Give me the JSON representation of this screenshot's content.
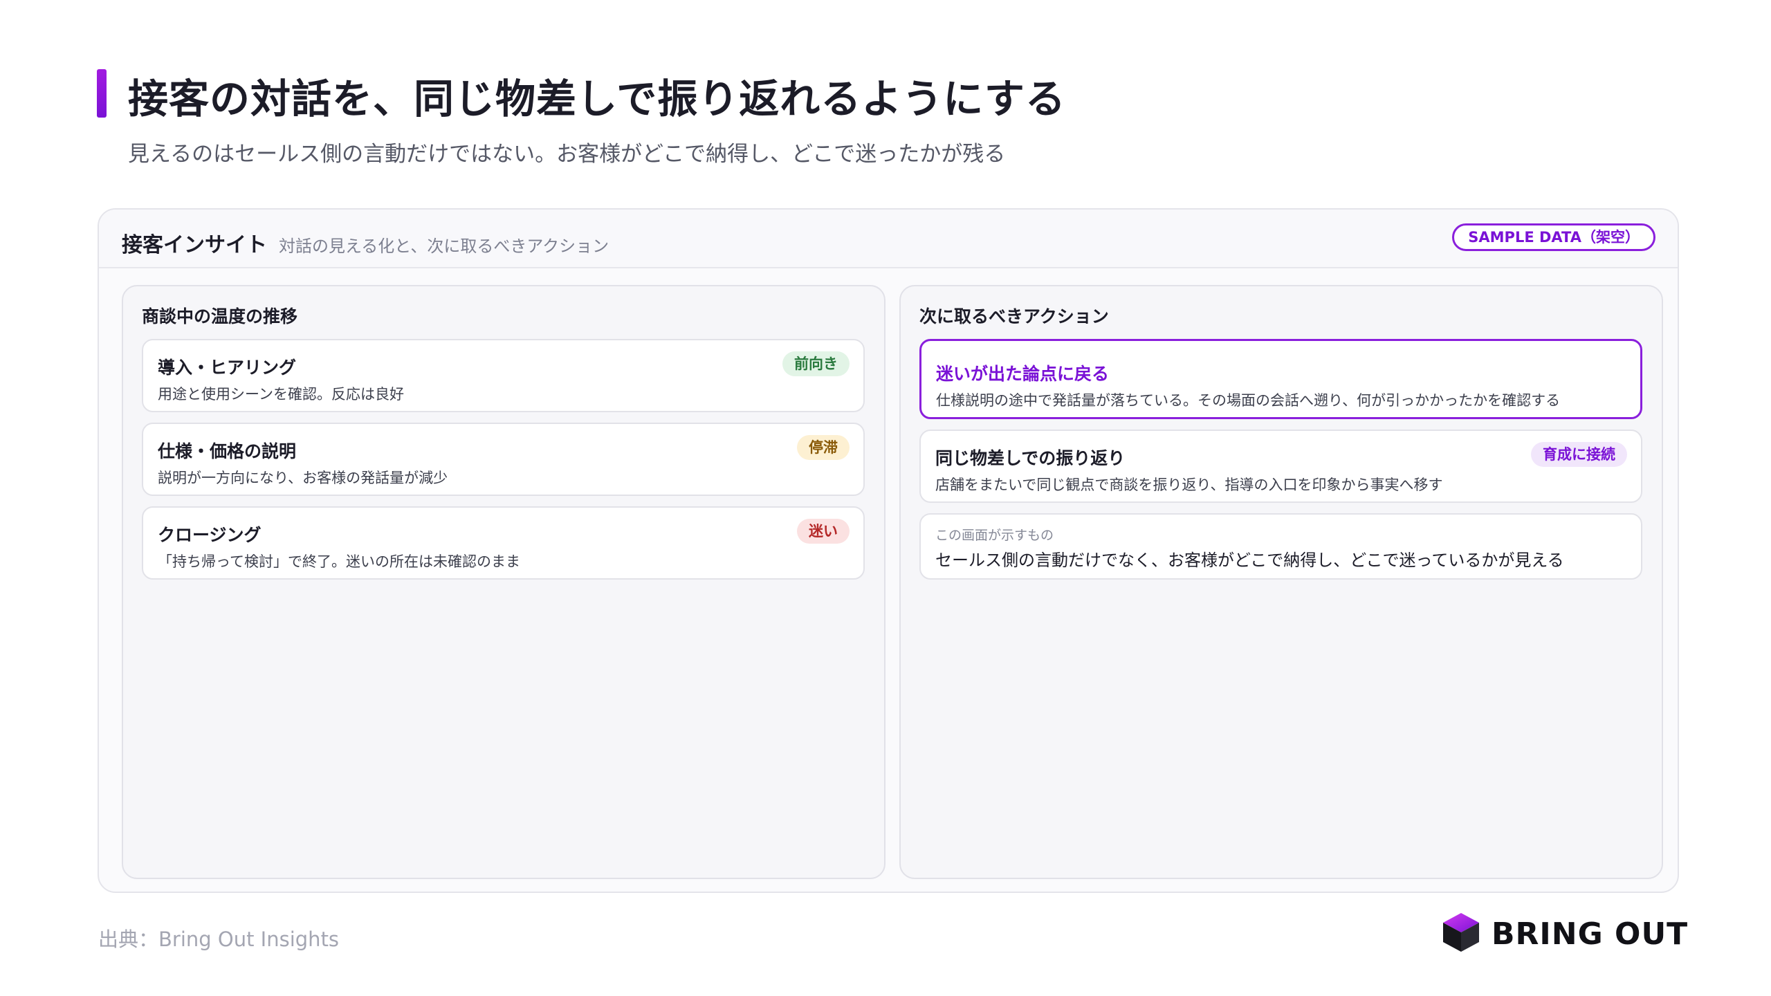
{
  "header": {
    "title": "接客の対話を、同じ物差しで振り返れるようにする",
    "subtitle": "見えるのはセールス側の言動だけではない。お客様がどこで納得し、どこで迷ったかが残る"
  },
  "panel": {
    "title": "接客インサイト",
    "subtitle": "対話の見える化と、次に取るべきアクション",
    "badge": "SAMPLE DATA（架空）"
  },
  "left": {
    "title": "商談中の温度の推移",
    "cards": [
      {
        "title": "導入・ヒアリング",
        "desc": "用途と使用シーンを確認。反応は良好",
        "tag": "前向き"
      },
      {
        "title": "仕様・価格の説明",
        "desc": "説明が一方向になり、お客様の発話量が減少",
        "tag": "停滞"
      },
      {
        "title": "クロージング",
        "desc": "「持ち帰って検討」で終了。迷いの所在は未確認のまま",
        "tag": "迷い"
      }
    ]
  },
  "right": {
    "title": "次に取るべきアクション",
    "cards": [
      {
        "title": "迷いが出た論点に戻る",
        "desc": "仕様説明の途中で発話量が落ちている。その場面の会話へ遡り、何が引っかかったかを確認する"
      },
      {
        "title": "同じ物差しでの振り返り",
        "desc": "店舗をまたいで同じ観点で商談を振り返り、指導の入口を印象から事実へ移す",
        "tag": "育成に接続"
      },
      {
        "label": "この画面が示すもの",
        "desc": "セールス側の言動だけでなく、お客様がどこで納得し、どこで迷っているかが見える"
      }
    ]
  },
  "footer": {
    "source": "出典：Bring Out Insights",
    "logo_text": "BRING OUT"
  },
  "colors": {
    "accent": "#8a1fdc",
    "positive": "#2a7a3e",
    "stalled": "#8a5a08",
    "hesitant": "#b42828"
  }
}
